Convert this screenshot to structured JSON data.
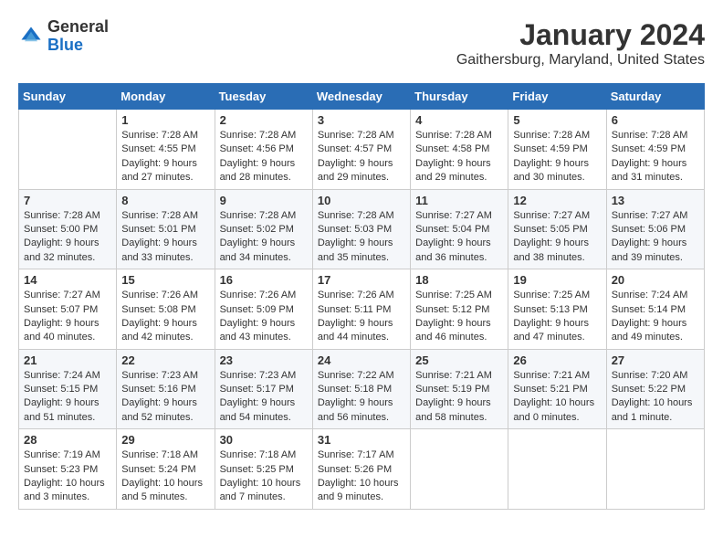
{
  "header": {
    "title": "January 2024",
    "subtitle": "Gaithersburg, Maryland, United States",
    "logo_general": "General",
    "logo_blue": "Blue"
  },
  "days_of_week": [
    "Sunday",
    "Monday",
    "Tuesday",
    "Wednesday",
    "Thursday",
    "Friday",
    "Saturday"
  ],
  "weeks": [
    [
      {
        "day": "",
        "info": ""
      },
      {
        "day": "1",
        "info": "Sunrise: 7:28 AM\nSunset: 4:55 PM\nDaylight: 9 hours\nand 27 minutes."
      },
      {
        "day": "2",
        "info": "Sunrise: 7:28 AM\nSunset: 4:56 PM\nDaylight: 9 hours\nand 28 minutes."
      },
      {
        "day": "3",
        "info": "Sunrise: 7:28 AM\nSunset: 4:57 PM\nDaylight: 9 hours\nand 29 minutes."
      },
      {
        "day": "4",
        "info": "Sunrise: 7:28 AM\nSunset: 4:58 PM\nDaylight: 9 hours\nand 29 minutes."
      },
      {
        "day": "5",
        "info": "Sunrise: 7:28 AM\nSunset: 4:59 PM\nDaylight: 9 hours\nand 30 minutes."
      },
      {
        "day": "6",
        "info": "Sunrise: 7:28 AM\nSunset: 4:59 PM\nDaylight: 9 hours\nand 31 minutes."
      }
    ],
    [
      {
        "day": "7",
        "info": "Sunrise: 7:28 AM\nSunset: 5:00 PM\nDaylight: 9 hours\nand 32 minutes."
      },
      {
        "day": "8",
        "info": "Sunrise: 7:28 AM\nSunset: 5:01 PM\nDaylight: 9 hours\nand 33 minutes."
      },
      {
        "day": "9",
        "info": "Sunrise: 7:28 AM\nSunset: 5:02 PM\nDaylight: 9 hours\nand 34 minutes."
      },
      {
        "day": "10",
        "info": "Sunrise: 7:28 AM\nSunset: 5:03 PM\nDaylight: 9 hours\nand 35 minutes."
      },
      {
        "day": "11",
        "info": "Sunrise: 7:27 AM\nSunset: 5:04 PM\nDaylight: 9 hours\nand 36 minutes."
      },
      {
        "day": "12",
        "info": "Sunrise: 7:27 AM\nSunset: 5:05 PM\nDaylight: 9 hours\nand 38 minutes."
      },
      {
        "day": "13",
        "info": "Sunrise: 7:27 AM\nSunset: 5:06 PM\nDaylight: 9 hours\nand 39 minutes."
      }
    ],
    [
      {
        "day": "14",
        "info": "Sunrise: 7:27 AM\nSunset: 5:07 PM\nDaylight: 9 hours\nand 40 minutes."
      },
      {
        "day": "15",
        "info": "Sunrise: 7:26 AM\nSunset: 5:08 PM\nDaylight: 9 hours\nand 42 minutes."
      },
      {
        "day": "16",
        "info": "Sunrise: 7:26 AM\nSunset: 5:09 PM\nDaylight: 9 hours\nand 43 minutes."
      },
      {
        "day": "17",
        "info": "Sunrise: 7:26 AM\nSunset: 5:11 PM\nDaylight: 9 hours\nand 44 minutes."
      },
      {
        "day": "18",
        "info": "Sunrise: 7:25 AM\nSunset: 5:12 PM\nDaylight: 9 hours\nand 46 minutes."
      },
      {
        "day": "19",
        "info": "Sunrise: 7:25 AM\nSunset: 5:13 PM\nDaylight: 9 hours\nand 47 minutes."
      },
      {
        "day": "20",
        "info": "Sunrise: 7:24 AM\nSunset: 5:14 PM\nDaylight: 9 hours\nand 49 minutes."
      }
    ],
    [
      {
        "day": "21",
        "info": "Sunrise: 7:24 AM\nSunset: 5:15 PM\nDaylight: 9 hours\nand 51 minutes."
      },
      {
        "day": "22",
        "info": "Sunrise: 7:23 AM\nSunset: 5:16 PM\nDaylight: 9 hours\nand 52 minutes."
      },
      {
        "day": "23",
        "info": "Sunrise: 7:23 AM\nSunset: 5:17 PM\nDaylight: 9 hours\nand 54 minutes."
      },
      {
        "day": "24",
        "info": "Sunrise: 7:22 AM\nSunset: 5:18 PM\nDaylight: 9 hours\nand 56 minutes."
      },
      {
        "day": "25",
        "info": "Sunrise: 7:21 AM\nSunset: 5:19 PM\nDaylight: 9 hours\nand 58 minutes."
      },
      {
        "day": "26",
        "info": "Sunrise: 7:21 AM\nSunset: 5:21 PM\nDaylight: 10 hours\nand 0 minutes."
      },
      {
        "day": "27",
        "info": "Sunrise: 7:20 AM\nSunset: 5:22 PM\nDaylight: 10 hours\nand 1 minute."
      }
    ],
    [
      {
        "day": "28",
        "info": "Sunrise: 7:19 AM\nSunset: 5:23 PM\nDaylight: 10 hours\nand 3 minutes."
      },
      {
        "day": "29",
        "info": "Sunrise: 7:18 AM\nSunset: 5:24 PM\nDaylight: 10 hours\nand 5 minutes."
      },
      {
        "day": "30",
        "info": "Sunrise: 7:18 AM\nSunset: 5:25 PM\nDaylight: 10 hours\nand 7 minutes."
      },
      {
        "day": "31",
        "info": "Sunrise: 7:17 AM\nSunset: 5:26 PM\nDaylight: 10 hours\nand 9 minutes."
      },
      {
        "day": "",
        "info": ""
      },
      {
        "day": "",
        "info": ""
      },
      {
        "day": "",
        "info": ""
      }
    ]
  ]
}
